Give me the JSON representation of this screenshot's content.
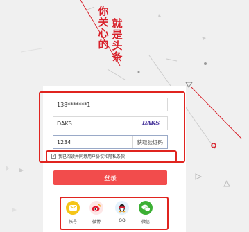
{
  "slogan": {
    "left_column": [
      "你",
      "关",
      "心",
      "的"
    ],
    "right_column": [
      "就",
      "是",
      "头",
      "条"
    ]
  },
  "form": {
    "phone_value": "138*******1",
    "captcha_value": "DAKS",
    "captcha_image_text": "DAKS",
    "sms_code_value": "1234",
    "sms_button_label": "获取验证码",
    "agreement_text": "我已阅读并同意用户协议和隐私条款",
    "agreement_checked": true,
    "login_button_label": "登录"
  },
  "social": [
    {
      "label": "帐号",
      "icon": "mail-icon",
      "color": "#f5c518"
    },
    {
      "label": "微博",
      "icon": "weibo-icon",
      "color": "#e6162d"
    },
    {
      "label": "QQ",
      "icon": "qq-penguin-icon",
      "color": "#1e9ce3"
    },
    {
      "label": "微信",
      "icon": "wechat-icon",
      "color": "#3cb034"
    }
  ],
  "colors": {
    "accent_red": "#e0241f",
    "login_button": "#f24c4c",
    "background": "#f0f0f0"
  }
}
